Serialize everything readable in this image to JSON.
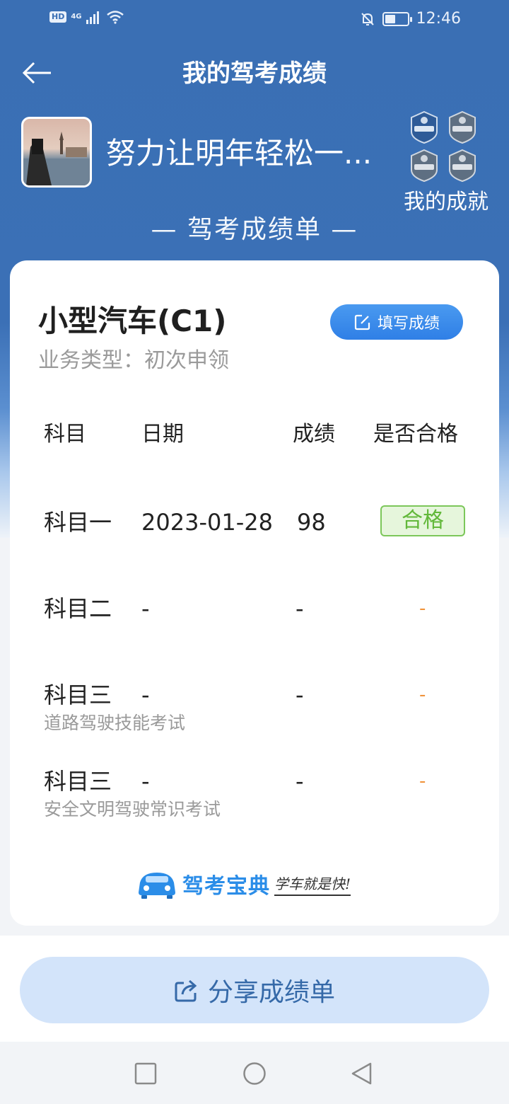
{
  "status_bar": {
    "hd": "HD",
    "network": "4G",
    "time": "12:46",
    "icons": [
      "hd-badge",
      "signal-icon",
      "wifi-icon",
      "mute-icon",
      "battery-icon"
    ]
  },
  "header": {
    "title": "我的驾考成绩",
    "back_icon": "arrow-left-icon"
  },
  "profile": {
    "username": "努力让明年轻松一...",
    "achievements_label": "我的成就"
  },
  "sheet_title": "— 驾考成绩单 —",
  "card": {
    "vehicle": "小型汽车(C1)",
    "business_type": "业务类型：初次申领",
    "fill_button": "填写成绩",
    "columns": [
      "科目",
      "日期",
      "成绩",
      "是否合格"
    ],
    "rows": [
      {
        "subject": "科目一",
        "sub": "",
        "date": "2023-01-28",
        "score": "98",
        "pass": "合格"
      },
      {
        "subject": "科目二",
        "sub": "",
        "date": "-",
        "score": "-",
        "pass": "-"
      },
      {
        "subject": "科目三",
        "sub": "道路驾驶技能考试",
        "date": "-",
        "score": "-",
        "pass": "-"
      },
      {
        "subject": "科目三",
        "sub": "安全文明驾驶常识考试",
        "date": "-",
        "score": "-",
        "pass": "-"
      }
    ],
    "brand_name": "驾考宝典",
    "brand_slogan": "学车就是快!"
  },
  "share_button": "分享成绩单",
  "colors": {
    "header_blue": "#3a6fb4",
    "primary_button": "#2f7fe6",
    "pass_green": "#62b83a",
    "dash_orange": "#f0933a",
    "share_bg": "#d3e4fa"
  }
}
